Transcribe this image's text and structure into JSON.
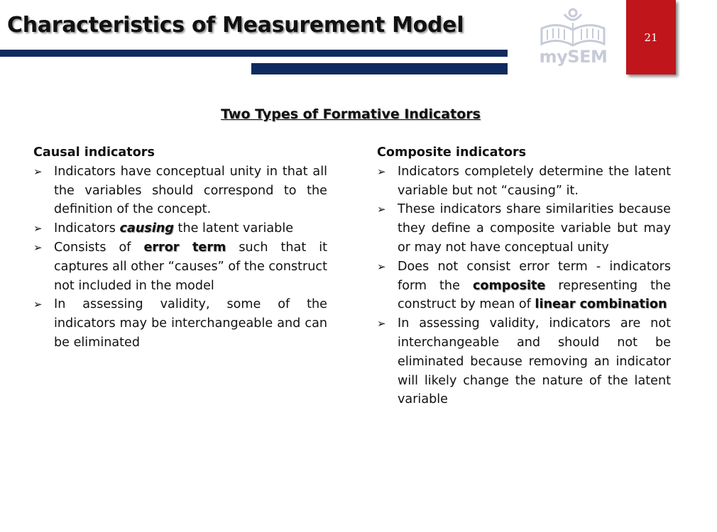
{
  "header": {
    "title": "Characteristics of Measurement Model",
    "page_number": "21",
    "logo_text": "mySEM",
    "accent_color": "#c0151b",
    "bar_color": "#0f2a5e"
  },
  "subtitle": "Two Types of Formative Indicators",
  "left": {
    "heading": "Causal indicators",
    "b1": "Indicators have conceptual unity in that all the variables should correspond to the definition of the concept.",
    "b2_pre": "Indicators ",
    "b2_em": "causing",
    "b2_post": " the latent variable",
    "b3_pre": "Consists of ",
    "b3_em": "error term",
    "b3_post": " such that it captures all other “causes” of the construct not included in the model",
    "b4": "In assessing validity, some of the indicators may be interchangeable and can be eliminated"
  },
  "right": {
    "heading": "Composite indicators",
    "b1": "Indicators completely determine the latent variable but not “causing” it.",
    "b2": "These indicators share similarities because they define a composite variable but may or may not have conceptual unity",
    "b3_pre": "Does not consist error term - indicators form the ",
    "b3_em": "composite",
    "b3_mid": " representing the construct by mean of ",
    "b3_em2": "linear combination",
    "b4": "In assessing validity, indicators are not interchangeable and should not be eliminated because removing an indicator will likely change the nature of the latent variable"
  }
}
